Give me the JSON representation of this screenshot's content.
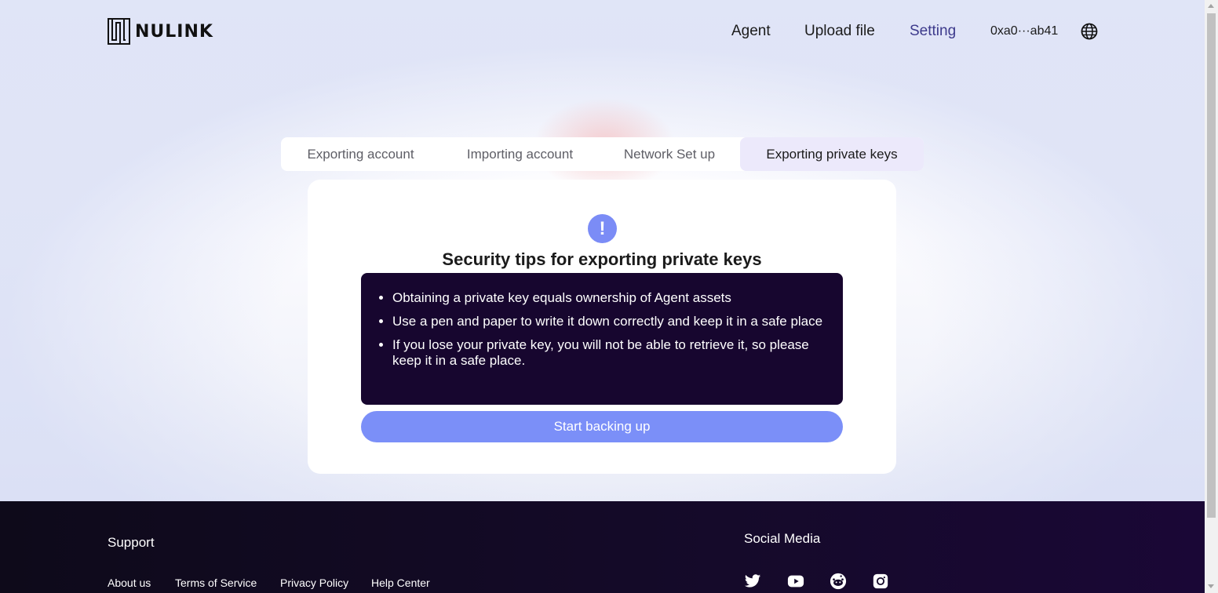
{
  "header": {
    "logo_text": "NULINK",
    "nav": {
      "agent": "Agent",
      "upload": "Upload file",
      "setting": "Setting"
    },
    "wallet_address": "0xa0···ab41",
    "globe_icon": "globe-icon"
  },
  "tabs": {
    "items": [
      {
        "label": "Exporting account"
      },
      {
        "label": "Importing account"
      },
      {
        "label": "Network Set up"
      },
      {
        "label": "Exporting private keys"
      }
    ],
    "selected": "Exporting private keys"
  },
  "card": {
    "icon": "exclamation-icon",
    "icon_glyph": "!",
    "title": "Security tips for exporting private keys",
    "tips": [
      "Obtaining a private key equals ownership of Agent assets",
      "Use a pen and paper to write it down correctly and keep it in a safe place",
      "If you lose your private key, you will not be able to retrieve it, so please keep it in a safe place."
    ],
    "button_label": "Start backing up"
  },
  "footer": {
    "support_title": "Support",
    "links": [
      "About us",
      "Terms of Service",
      "Privacy Policy",
      "Help Center"
    ],
    "social_title": "Social Media",
    "social_icons": [
      "twitter-icon",
      "youtube-icon",
      "reddit-icon",
      "instagram-icon"
    ]
  },
  "colors": {
    "accent": "#7b8ff8",
    "active_nav": "#3d3a8c",
    "tips_bg": "#17062f",
    "footer_bg": "#150a2a",
    "tab_selected_bg": "#ece9fb"
  }
}
